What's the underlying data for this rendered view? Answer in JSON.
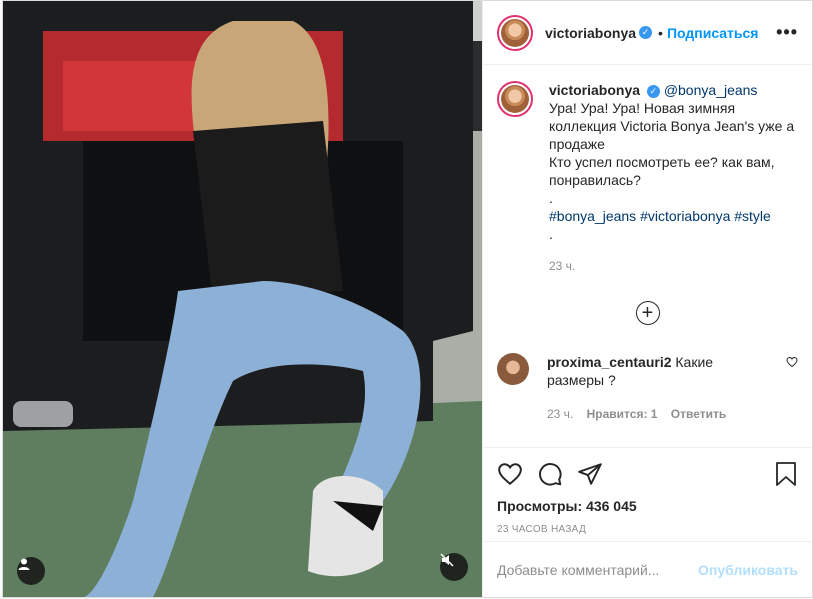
{
  "post": {
    "author": "victoriabonya",
    "follow_label": "Подписаться",
    "dot": "•",
    "more_label": "•••"
  },
  "caption": {
    "author": "victoriabonya",
    "mention": "@bonya_jeans",
    "line1": "Ура! Ура! Ура! Новая зимняя коллекция Victoria Bonya Jean's уже а продаже",
    "line2": "Кто успел посмотреть ее? как вам, понравилась?",
    "dot_line": ".",
    "hashtags": [
      "#bonya_jeans",
      "#victoriabonya",
      "#style"
    ],
    "dot_line2": ".",
    "time": "23 ч."
  },
  "comment": {
    "author": "proxima_centauri2",
    "text": "Какие размеры ?",
    "time": "23 ч.",
    "likes": "Нравится: 1",
    "reply": "Ответить"
  },
  "stats": {
    "views_label": "Просмотры:",
    "views_value": "436 045",
    "ago": "23 ЧАСОВ НАЗАД"
  },
  "add_comment": {
    "placeholder": "Добавьте комментарий...",
    "publish": "Опубликовать"
  },
  "colors": {
    "accent": "#0095f6",
    "verified": "#3897f0"
  },
  "icons": [
    "user-tag-icon",
    "mute-icon",
    "verified-icon",
    "more-icon",
    "plus-icon",
    "heart-icon",
    "comment-icon",
    "share-icon",
    "save-icon"
  ]
}
